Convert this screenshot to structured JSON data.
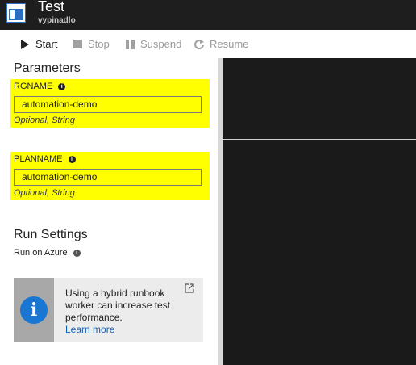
{
  "header": {
    "title": "Test",
    "subtitle": "vypinadlo"
  },
  "toolbar": {
    "start_label": "Start",
    "stop_label": "Stop",
    "suspend_label": "Suspend",
    "resume_label": "Resume"
  },
  "parameters": {
    "heading": "Parameters",
    "items": [
      {
        "name": "RGNAME",
        "value": "automation-demo",
        "hint": "Optional, String"
      },
      {
        "name": "PLANNAME",
        "value": "automation-demo",
        "hint": "Optional, String"
      }
    ]
  },
  "run_settings": {
    "heading": "Run Settings",
    "run_on_label": "Run on Azure"
  },
  "info_card": {
    "text": "Using a hybrid runbook worker can increase test performance.",
    "link_label": "Learn more"
  },
  "colors": {
    "highlight": "#ffff00",
    "header_bg": "#1e1e1e",
    "accent_blue": "#1976d2",
    "output_pane_bg": "#1a1a1a"
  }
}
